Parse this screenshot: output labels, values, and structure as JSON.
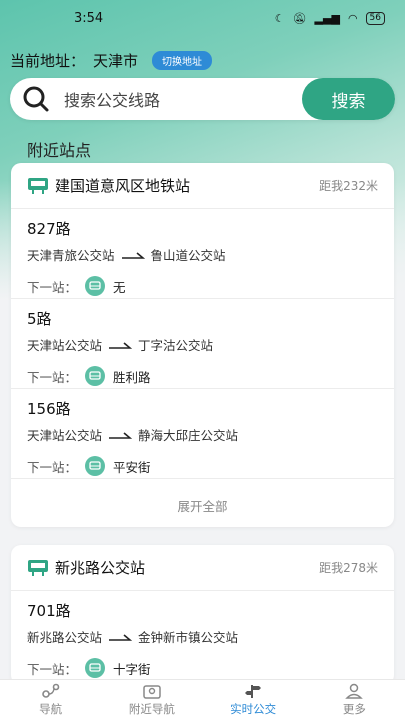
{
  "status_bar": {
    "time": "3:54",
    "battery": "56"
  },
  "address": {
    "label": "当前地址：",
    "city": "天津市",
    "switch_label": "切换地址"
  },
  "search": {
    "placeholder": "搜索公交线路",
    "button_label": "搜索"
  },
  "nearby": {
    "title": "附近站点",
    "stations": [
      {
        "name": "建国道意风区地铁站",
        "distance": "距我232米",
        "routes": [
          {
            "name": "827路",
            "from": "天津青旅公交站",
            "to": "鲁山道公交站",
            "next_label": "下一站：",
            "next_stop": "无"
          },
          {
            "name": "5路",
            "from": "天津站公交站",
            "to": "丁字沽公交站",
            "next_label": "下一站：",
            "next_stop": "胜利路"
          },
          {
            "name": "156路",
            "from": "天津站公交站",
            "to": "静海大邱庄公交站",
            "next_label": "下一站：",
            "next_stop": "平安街"
          }
        ],
        "expand_label": "展开全部"
      },
      {
        "name": "新兆路公交站",
        "distance": "距我278米",
        "routes": [
          {
            "name": "701路",
            "from": "新兆路公交站",
            "to": "金钟新市镇公交站",
            "next_label": "下一站：",
            "next_stop": "十字街"
          }
        ]
      }
    ]
  },
  "tabbar": {
    "items": [
      {
        "label": "导航",
        "icon": "route-icon"
      },
      {
        "label": "附近导航",
        "icon": "map-pin-icon"
      },
      {
        "label": "实时公交",
        "icon": "sign-post-icon"
      },
      {
        "label": "更多",
        "icon": "person-icon"
      }
    ],
    "active_index": 2
  },
  "colors": {
    "accent": "#2fa584",
    "tab_active": "#2e8bd6",
    "switch_btn": "#2e8bd6"
  }
}
